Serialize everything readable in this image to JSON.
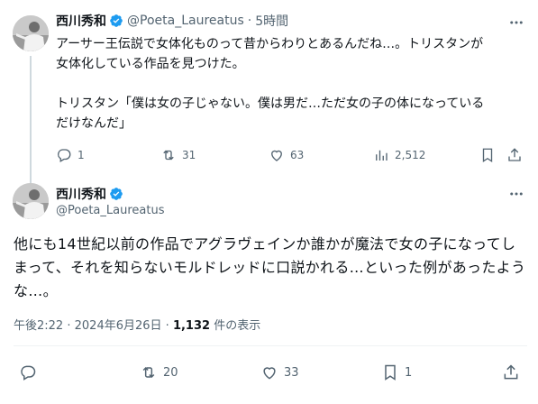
{
  "colors": {
    "verified": "#1d9bf0",
    "text": "#0f1419",
    "muted": "#536471",
    "line": "#cfd9de"
  },
  "tweet1": {
    "author_name": "西川秀和",
    "handle": "@Poeta_Laureatus",
    "separator": "·",
    "time": "5時間",
    "body": "アーサー王伝説で女体化ものって昔からわりとあるんだね…。トリスタンが\n女体化している作品を見つけた。\n\nトリスタン「僕は女の子じゃない。僕は男だ…ただ女の子の体になっている\nだけなんだ」",
    "replies": "1",
    "reposts": "31",
    "likes": "63",
    "views": "2,512",
    "icons": [
      "reply-icon",
      "repost-icon",
      "like-icon",
      "views-icon",
      "bookmark-icon",
      "share-icon",
      "more-icon",
      "verified-badge-icon"
    ]
  },
  "tweet2": {
    "author_name": "西川秀和",
    "handle": "@Poeta_Laureatus",
    "body": "他にも14世紀以前の作品でアグラヴェインか誰かが魔法で女の子になってしまって、それを知らないモルドレッドに口説かれる…といった例があったような…。",
    "time": "午後2:22",
    "separator": "·",
    "date": "2024年6月26日",
    "views_count": "1,132",
    "views_label": "件の表示",
    "reposts": "20",
    "likes": "33",
    "bookmarks": "1"
  }
}
